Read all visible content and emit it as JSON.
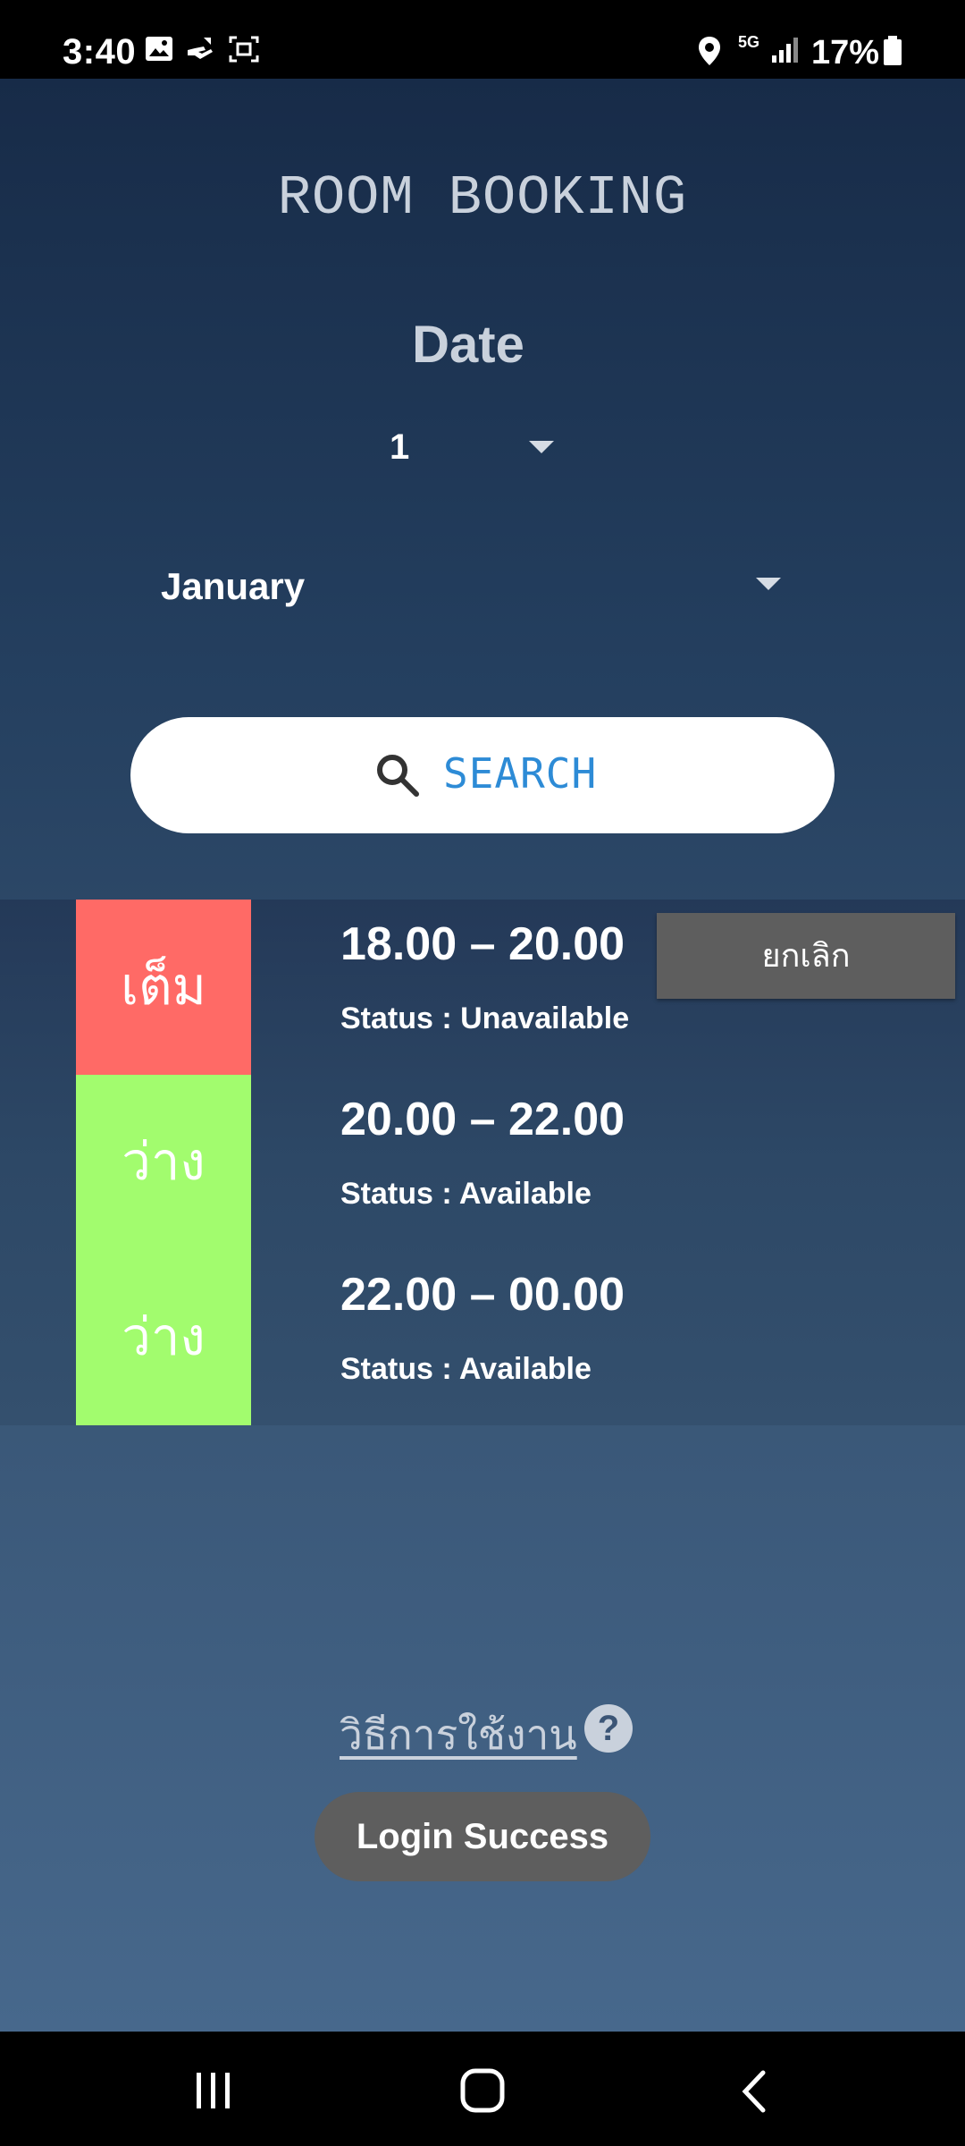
{
  "status_bar": {
    "time": "3:40",
    "network": "5G",
    "battery": "17%"
  },
  "header": {
    "title": "ROOM BOOKING",
    "date_label": "Date"
  },
  "filters": {
    "day_value": "1",
    "month_value": "January"
  },
  "search": {
    "label": "SEARCH"
  },
  "slots": [
    {
      "badge": "เต็ม",
      "badge_color": "#ff6a66",
      "time": "18.00 – 20.00",
      "status": "Status : Unavailable",
      "cancel_label": "ยกเลิก"
    },
    {
      "badge": "ว่าง",
      "badge_color": "#a2fc6e",
      "time": "20.00 – 22.00",
      "status": "Status : Available"
    },
    {
      "badge": "ว่าง",
      "badge_color": "#a2fc6e",
      "time": "22.00 – 00.00",
      "status": "Status : Available"
    }
  ],
  "help": {
    "label": "วิธีการใช้งาน",
    "icon": "?"
  },
  "toast": {
    "message": "Login Success"
  },
  "colors": {
    "accent": "#2d8bd6",
    "unavailable": "#ff6a66",
    "available": "#a2fc6e"
  }
}
